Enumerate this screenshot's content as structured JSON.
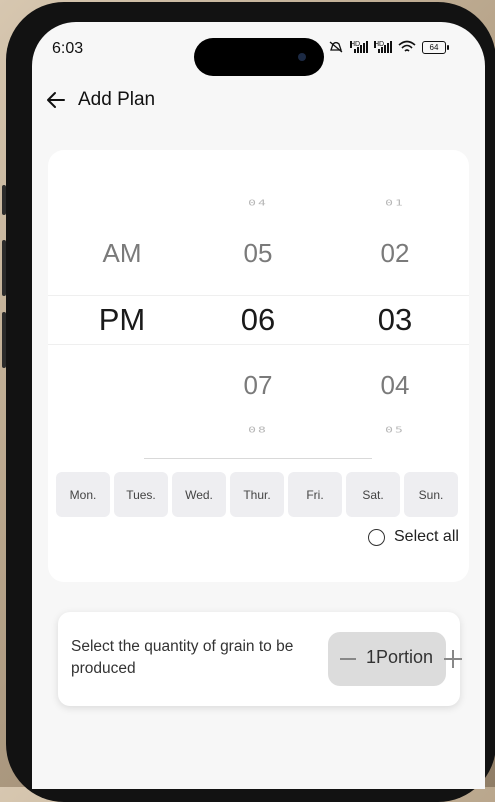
{
  "status_bar": {
    "time": "6:03",
    "hd_label": "HD",
    "battery": "64"
  },
  "header": {
    "title": "Add Plan"
  },
  "time_picker": {
    "period": {
      "above": "AM",
      "selected": "PM"
    },
    "hours": {
      "faint_above": "04",
      "above": "05",
      "selected": "06",
      "below": "07",
      "faint_below": "08"
    },
    "minutes": {
      "faint_above": "01",
      "above": "02",
      "selected": "03",
      "below": "04",
      "faint_below": "05"
    }
  },
  "days": [
    "Mon.",
    "Tues.",
    "Wed.",
    "Thur.",
    "Fri.",
    "Sat.",
    "Sun."
  ],
  "select_all": {
    "label": "Select all",
    "checked": false
  },
  "quantity": {
    "label": "Select the quantity of grain to be produced",
    "value": "1Portion"
  }
}
